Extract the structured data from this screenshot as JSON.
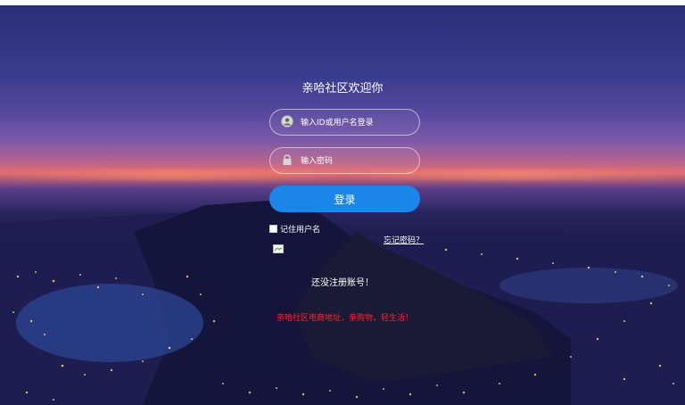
{
  "page": {
    "title": "亲哈社区欢迎你"
  },
  "form": {
    "username_placeholder": "输入ID或用户名登录",
    "password_placeholder": "输入密码",
    "login_label": "登录",
    "remember_label": "记住用户名",
    "forgot_label": "忘记密码？"
  },
  "footer": {
    "register_label": "还没注册账号！",
    "slogan": "亲哈社区电商地址，亲购物，轻生活！"
  },
  "colors": {
    "button": "#1b86e8",
    "slogan": "#ff2626"
  },
  "icons": {
    "username": "user-avatar-icon",
    "password": "lock-icon",
    "broken_image": "broken-image-icon"
  }
}
